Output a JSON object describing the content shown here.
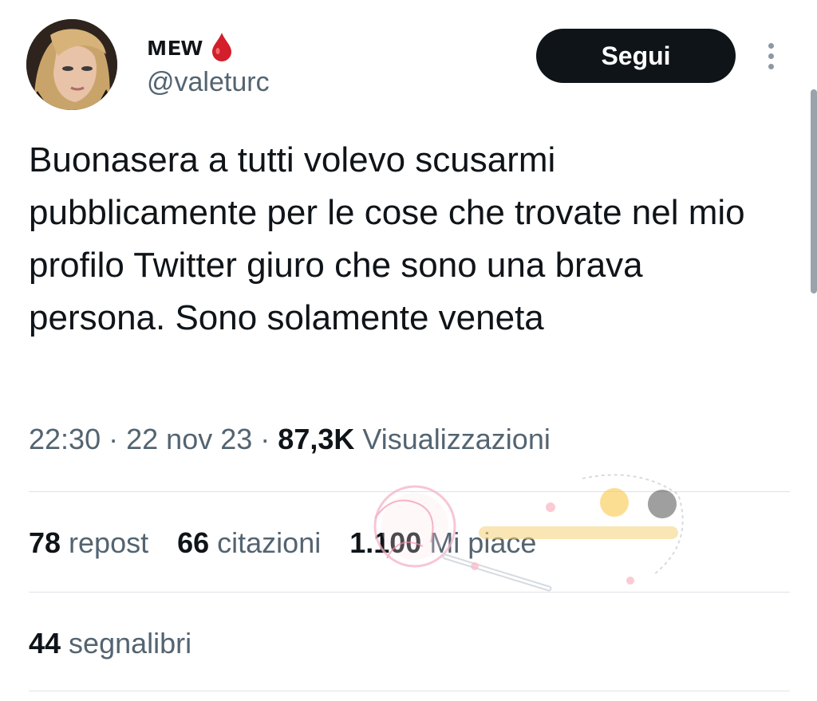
{
  "author": {
    "display_name": "ᴍᴇᴡ",
    "emoji_icon": "drop-of-blood-icon",
    "handle": "@valeturc"
  },
  "follow_button": {
    "label": "Segui"
  },
  "tweet": {
    "text": "Buonasera a tutti volevo scusarmi pubblicamente per le cose che trovate nel mio profilo Twitter giuro che sono una brava persona. Sono solamente veneta",
    "time": "22:30",
    "separator": "·",
    "date": "22 nov 23",
    "views_count": "87,3K",
    "views_label": "Visualizzazioni"
  },
  "stats": {
    "reposts": {
      "count": "78",
      "label": "repost"
    },
    "quotes": {
      "count": "66",
      "label": "citazioni"
    },
    "likes": {
      "count": "1.100",
      "label": "Mi piace"
    },
    "bookmarks": {
      "count": "44",
      "label": "segnalibri"
    }
  },
  "colors": {
    "button_bg": "#0f1419",
    "secondary_text": "#536471",
    "divider": "#dfe3e7",
    "blood_drop": "#d21f2b"
  }
}
